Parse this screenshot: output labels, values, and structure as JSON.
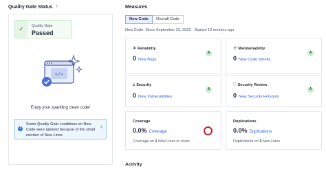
{
  "left": {
    "title": "Quality Gate Status",
    "gate_label": "Quality Gate",
    "gate_status": "Passed",
    "clean_message": "Enjoy your sparkling clean code!",
    "info_text": "Some Quality Gate conditions on New Code were ignored because of the small number of New Lines"
  },
  "right": {
    "title": "Measures",
    "tabs": [
      {
        "label": "New Code",
        "active": true
      },
      {
        "label": "Overall Code",
        "active": false
      }
    ],
    "new_code_info": "New Code: Since September 23, 2023 · Started 12 minutes ago",
    "cards": {
      "reliability": {
        "title": "Reliability",
        "value": "0",
        "label": "New Bugs",
        "grade": "A"
      },
      "maintainability": {
        "title": "Maintainability",
        "value": "0",
        "label": "New Code Smells",
        "grade": "A"
      },
      "security": {
        "title": "Security",
        "value": "0",
        "label": "New Vulnerabilities",
        "grade": "A"
      },
      "security_review": {
        "title": "Security Review",
        "value": "0",
        "label": "New Security Hotspots",
        "grade": "A"
      },
      "coverage": {
        "title": "Coverage",
        "value": "0.0%",
        "label": "Coverage",
        "foot_prefix": "Coverage on",
        "foot_num": "1",
        "foot_suffix": "New Lines to cover"
      },
      "duplications": {
        "title": "Duplications",
        "value": "0.0%",
        "label": "Duplications",
        "foot_prefix": "Duplications on",
        "foot_num": "3",
        "foot_suffix": "New Lines"
      }
    },
    "activity_title": "Activity"
  },
  "colors": {
    "grade_a": "#c9ecd2",
    "link": "#2b5fd9",
    "coverage_ring": "#c0272d",
    "passed_bg": "#f4fbf4",
    "info_bg": "#eef6fd"
  },
  "icons": {
    "help": "question-icon",
    "check": "check-icon",
    "info": "info-icon",
    "reliability": "bug-icon",
    "maintainability": "code-smell-icon",
    "security": "lock-icon",
    "security_review": "shield-icon"
  }
}
